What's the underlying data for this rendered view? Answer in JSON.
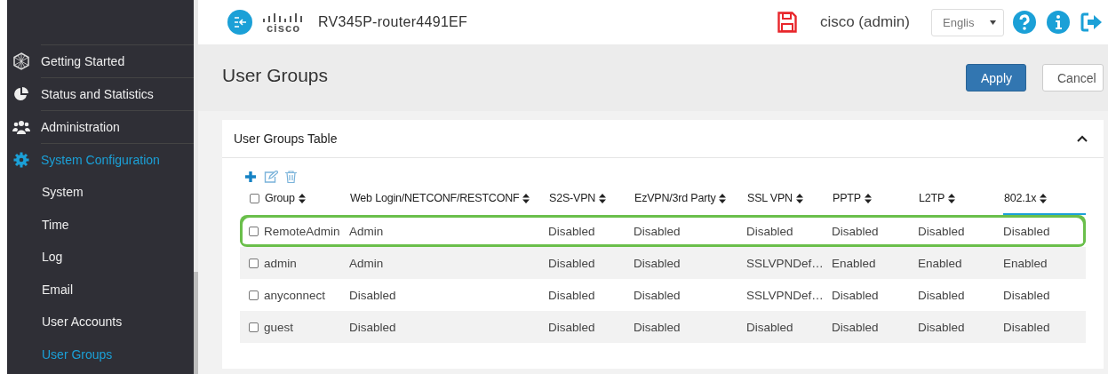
{
  "header": {
    "logo_text": "cisco",
    "device_name": "RV345P-router4491EF",
    "user": "cisco (admin)",
    "language": "Englis"
  },
  "sidebar": {
    "items": [
      {
        "label": "Getting Started",
        "selected": false
      },
      {
        "label": "Status and Statistics",
        "selected": false
      },
      {
        "label": "Administration",
        "selected": false
      },
      {
        "label": "System Configuration",
        "selected": true,
        "expanded": true,
        "children": [
          {
            "label": "System",
            "selected": false
          },
          {
            "label": "Time",
            "selected": false
          },
          {
            "label": "Log",
            "selected": false
          },
          {
            "label": "Email",
            "selected": false
          },
          {
            "label": "User Accounts",
            "selected": false
          },
          {
            "label": "User Groups",
            "selected": true
          }
        ]
      }
    ]
  },
  "page": {
    "title": "User Groups",
    "buttons": [
      {
        "label": "Apply",
        "kind": "primary"
      },
      {
        "label": "Cancel",
        "kind": "secondary"
      }
    ]
  },
  "table": {
    "title": "User Groups Table",
    "expanded": true,
    "all_checked": false,
    "columns": [
      "Group",
      "Web Login/NETCONF/RESTCONF",
      "S2S-VPN",
      "EzVPN/3rd Party",
      "SSL VPN",
      "PPTP",
      "L2TP",
      "802.1x"
    ],
    "rows": [
      {
        "checked": false,
        "highlighted": true,
        "cells": [
          "RemoteAdmin",
          "Admin",
          "Disabled",
          "Disabled",
          "Disabled",
          "Disabled",
          "Disabled",
          "Disabled"
        ]
      },
      {
        "checked": false,
        "highlighted": false,
        "cells": [
          "admin",
          "Admin",
          "Disabled",
          "Disabled",
          "SSLVPNDef…",
          "Enabled",
          "Enabled",
          "Enabled"
        ]
      },
      {
        "checked": false,
        "highlighted": false,
        "cells": [
          "anyconnect",
          "Disabled",
          "Disabled",
          "Disabled",
          "SSLVPNDef…",
          "Disabled",
          "Disabled",
          "Disabled"
        ]
      },
      {
        "checked": false,
        "highlighted": false,
        "cells": [
          "guest",
          "Disabled",
          "Disabled",
          "Disabled",
          "Disabled",
          "Disabled",
          "Disabled",
          "Disabled"
        ]
      }
    ]
  }
}
